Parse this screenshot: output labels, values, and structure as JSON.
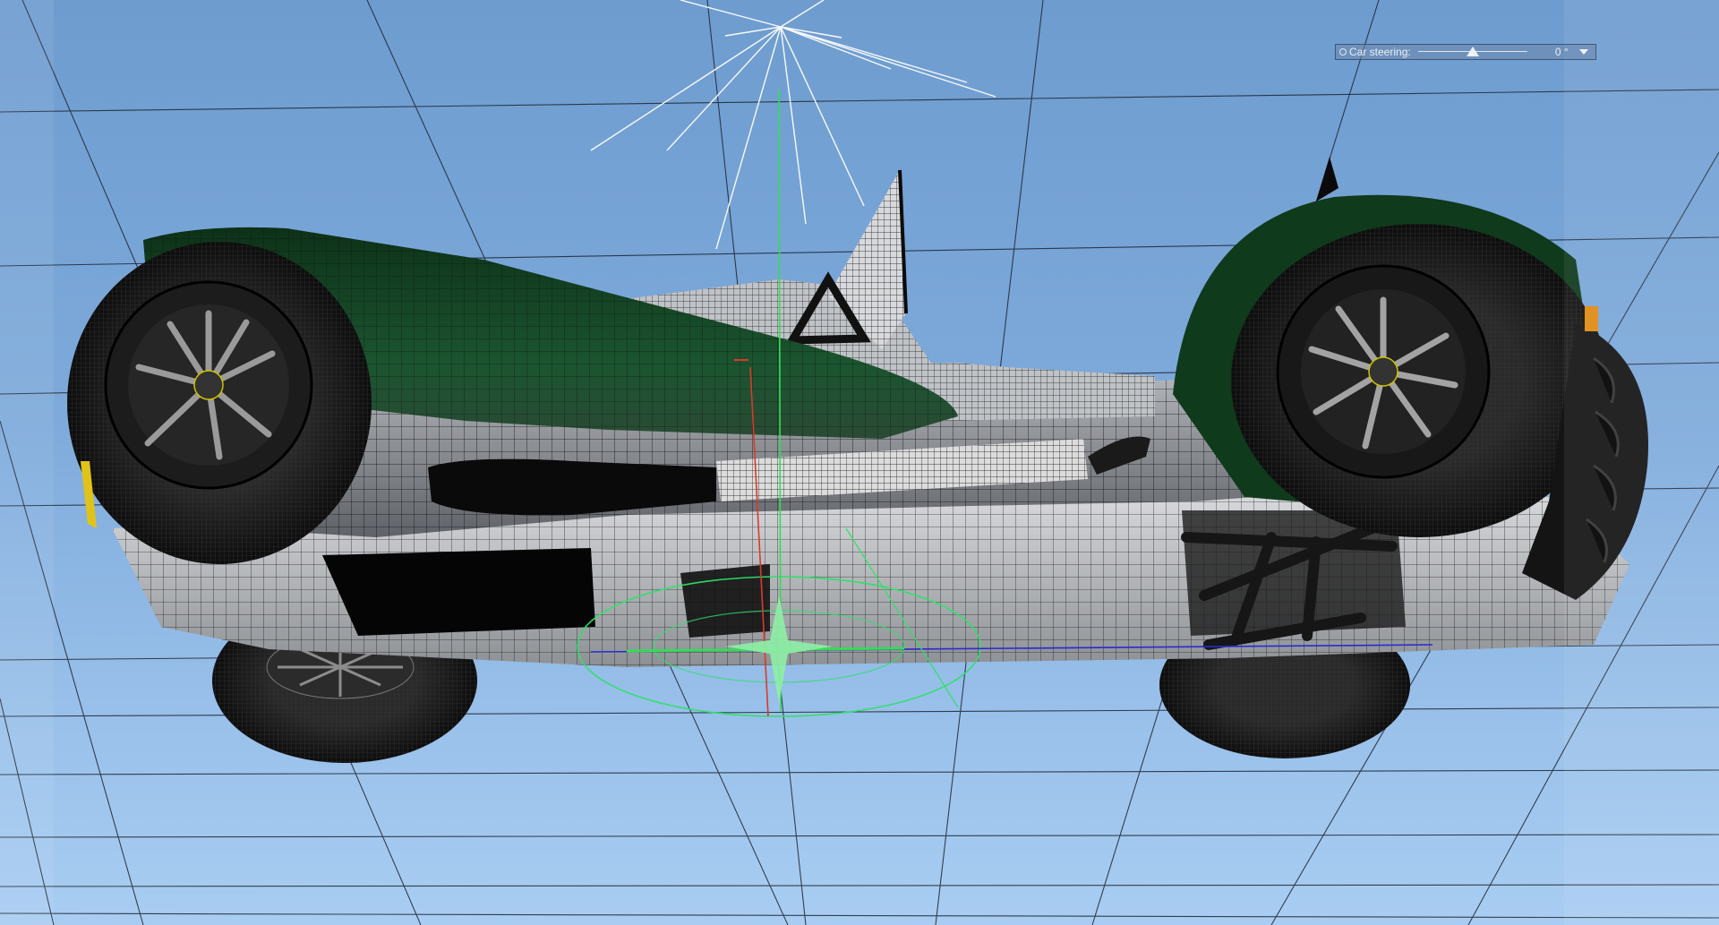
{
  "viewport": {
    "name": "3D viewport",
    "background_top": "#6e9ccf",
    "background_bottom": "#a9cdf2",
    "grid_color": "#1e2633"
  },
  "hud": {
    "label": "Car steering:",
    "value": "0 °",
    "steering_fraction": 0.5,
    "dropdown_icon": "chevron-down-icon"
  },
  "model": {
    "body_color": "#0f3a1c",
    "metal_color": "#8a8d92",
    "tire_color": "#161616",
    "wire_color": "#101010",
    "indicator_color": "#e08a14",
    "reflector_color": "#e0c21a"
  },
  "gizmo": {
    "x_axis_color": "#2a2ad0",
    "y_axis_color": "#33dd55",
    "z_axis_color": "#d93a2a",
    "ring_color": "#2fe06a",
    "light_color": "#ffffff"
  }
}
